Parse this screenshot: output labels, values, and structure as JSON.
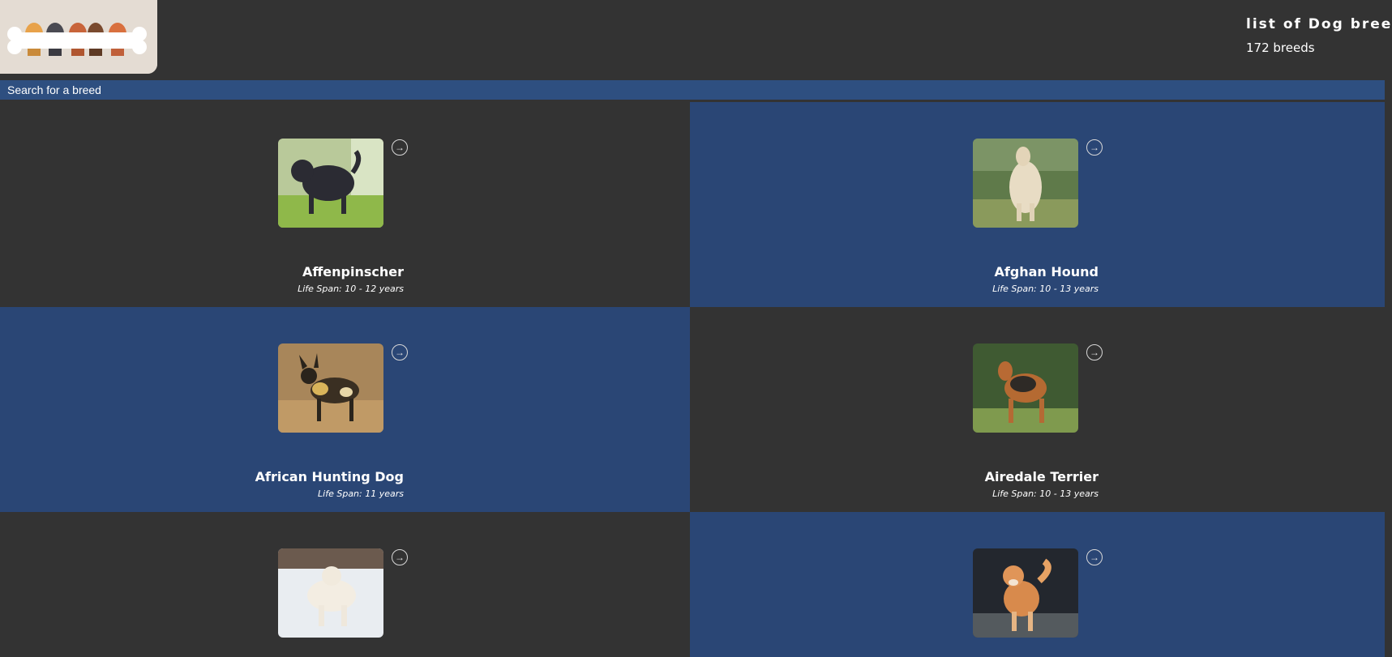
{
  "header": {
    "title": "list of Dog breeds",
    "count": "172 breeds",
    "logo_icon": "dogs-with-bone-logo"
  },
  "search": {
    "placeholder": "Search for a breed"
  },
  "colors": {
    "background": "#333333",
    "card_blue": "#2a4675",
    "search_bar": "#2e4f80",
    "cursor_accent": "#e11d2a"
  },
  "breeds": [
    {
      "name": "Affenpinscher",
      "life_span": "Life Span: 10 - 12 years",
      "icon": "arrow-right-circle-icon"
    },
    {
      "name": "Afghan Hound",
      "life_span": "Life Span: 10 - 13 years",
      "icon": "arrow-right-circle-icon"
    },
    {
      "name": "African Hunting Dog",
      "life_span": "Life Span: 11 years",
      "icon": "arrow-right-circle-icon"
    },
    {
      "name": "Airedale Terrier",
      "life_span": "Life Span: 10 - 13 years",
      "icon": "arrow-right-circle-icon"
    },
    {
      "name": "",
      "life_span": "",
      "icon": "arrow-right-circle-icon"
    },
    {
      "name": "",
      "life_span": "",
      "icon": "arrow-right-circle-icon"
    }
  ]
}
